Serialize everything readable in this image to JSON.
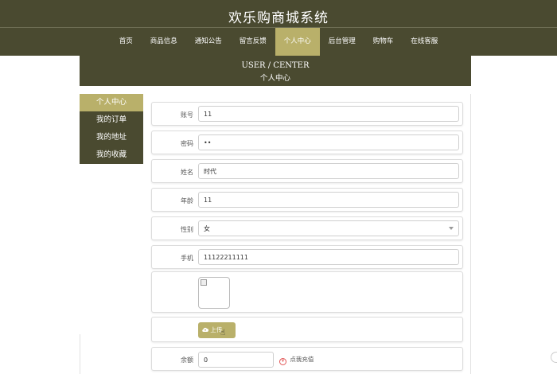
{
  "header": {
    "title": "欢乐购商城系统"
  },
  "nav": {
    "items": [
      "首页",
      "商品信息",
      "通知公告",
      "留言反馈",
      "个人中心",
      "后台管理",
      "购物车",
      "在线客服"
    ],
    "active_index": 4
  },
  "banner": {
    "en": "USER / CENTER",
    "cn": "个人中心"
  },
  "sidebar": {
    "items": [
      "个人中心",
      "我的订单",
      "我的地址",
      "我的收藏"
    ],
    "active_index": 0
  },
  "form": {
    "account": {
      "label": "账号",
      "value": "11"
    },
    "password": {
      "label": "密码",
      "value": "••"
    },
    "name": {
      "label": "姓名",
      "value": "时代"
    },
    "age": {
      "label": "年龄",
      "value": "11"
    },
    "gender": {
      "label": "性别",
      "value": "女"
    },
    "phone": {
      "label": "手机",
      "value": "11122211111"
    },
    "upload": {
      "label": "上传"
    },
    "balance": {
      "label": "余额",
      "value": "0",
      "recharge": "点我充值"
    }
  },
  "colors": {
    "dark": "#4a4a30",
    "accent": "#b9b06a"
  },
  "icons": {
    "upload": "cloud-upload-icon",
    "recharge": "recharge-icon"
  }
}
